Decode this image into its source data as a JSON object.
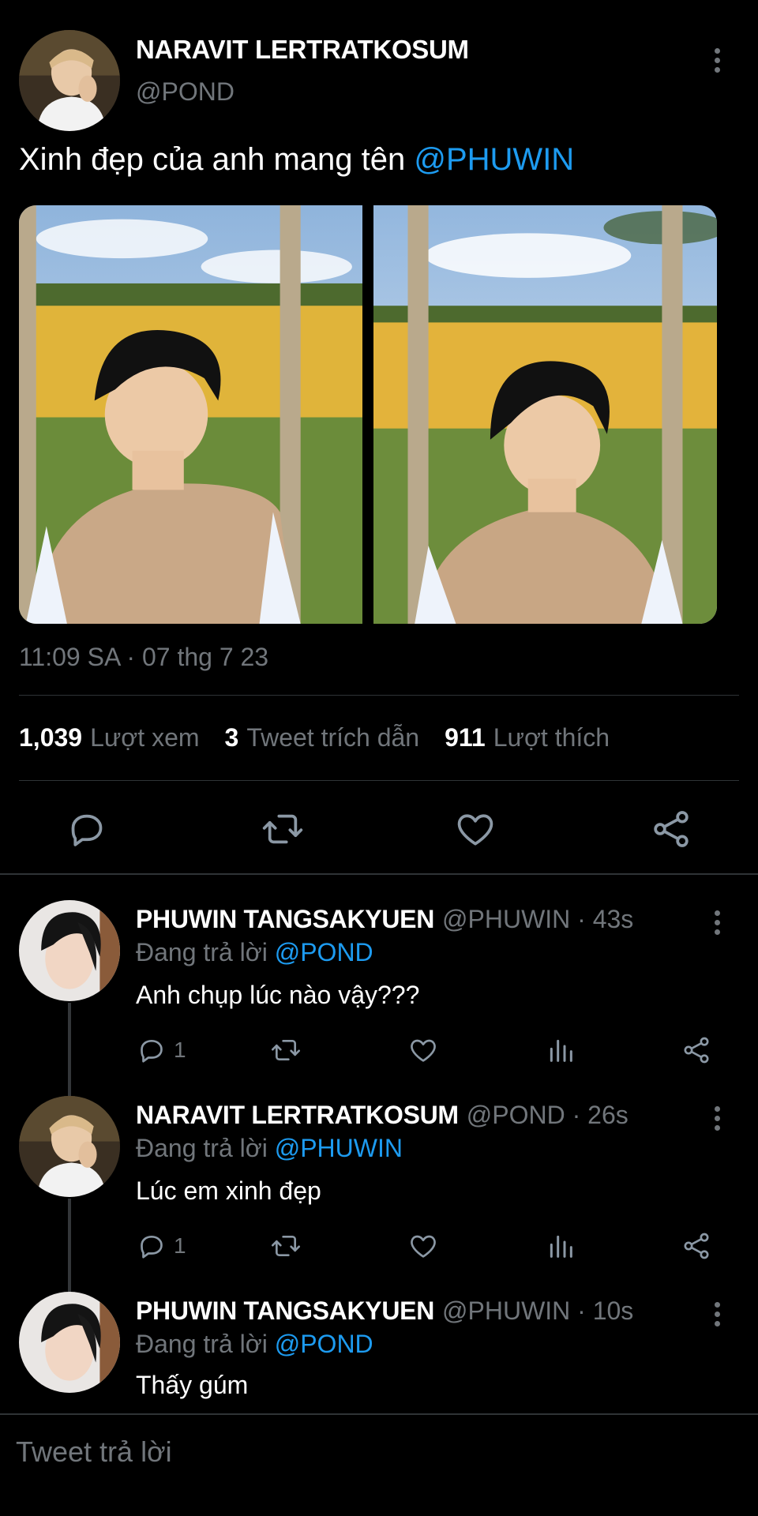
{
  "main_tweet": {
    "display_name": "NARAVIT LERTRATKOSUM",
    "handle": "@POND",
    "text_prefix": "Xinh đẹp của anh mang tên ",
    "text_mention": "@PHUWIN",
    "timestamp": "11:09 SA · 07 thg 7 23",
    "stats": {
      "views_count": "1,039",
      "views_label": "Lượt xem",
      "quotes_count": "3",
      "quotes_label": "Tweet trích dẫn",
      "likes_count": "911",
      "likes_label": "Lượt thích"
    },
    "actions": [
      "reply-icon",
      "retweet-icon",
      "like-icon",
      "share-icon"
    ]
  },
  "replies": [
    {
      "display_name": "PHUWIN TANGSAKYUEN",
      "meta": "@PHUWIN · 43s",
      "replying_prefix": "Đang trả lời ",
      "replying_to": "@POND",
      "text": "Anh chụp lúc nào vậy???",
      "reply_count": "1"
    },
    {
      "display_name": "NARAVIT LERTRATKOSUM",
      "meta": "@POND · 26s",
      "replying_prefix": "Đang trả lời ",
      "replying_to": "@PHUWIN",
      "text": "Lúc em xinh đẹp",
      "reply_count": "1"
    },
    {
      "display_name": "PHUWIN TANGSAKYUEN",
      "meta": "@PHUWIN · 10s",
      "replying_prefix": "Đang trả lời ",
      "replying_to": "@POND",
      "text": "Thấy gúm"
    }
  ],
  "compose": {
    "placeholder": "Tweet trả lời"
  },
  "colors": {
    "background": "#000000",
    "accent": "#1d9bf0",
    "muted": "#71767b",
    "divider": "#2f3336"
  }
}
